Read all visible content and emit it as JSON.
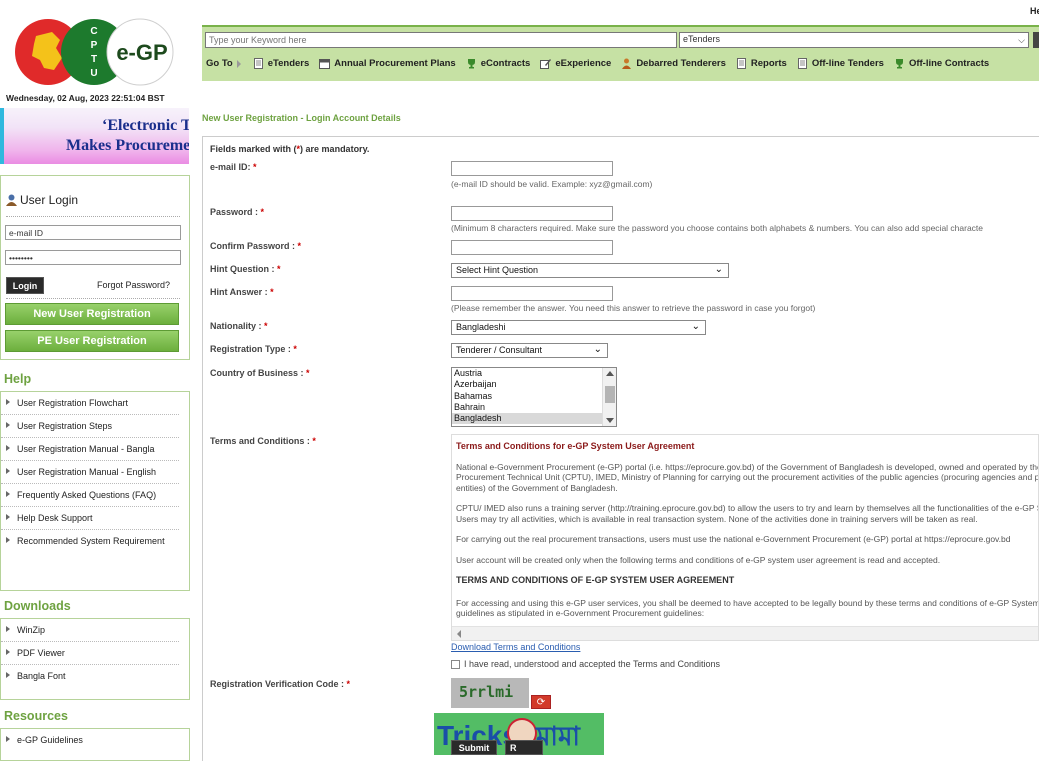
{
  "header": {
    "corner_text": "He",
    "datetime": "Wednesday, 02 Aug, 2023 22:51:04 BST",
    "logo_letters": [
      "C",
      "P",
      "T",
      "U"
    ],
    "logo_text": "e-GP",
    "banner_line1": "‘Electronic Te",
    "banner_line2": "Makes Procuremer"
  },
  "search": {
    "keyword_placeholder": "Type your Keyword here",
    "category_value": "eTenders"
  },
  "menu": {
    "goto_label": "Go To",
    "items": [
      {
        "label": "eTenders",
        "icon": "document-icon"
      },
      {
        "label": "Annual Procurement Plans",
        "icon": "calendar-icon"
      },
      {
        "label": "eContracts",
        "icon": "trophy-icon"
      },
      {
        "label": "eExperience",
        "icon": "edit-icon"
      },
      {
        "label": "Debarred Tenderers",
        "icon": "person-icon"
      },
      {
        "label": "Reports",
        "icon": "document-icon"
      },
      {
        "label": "Off-line Tenders",
        "icon": "document-icon"
      },
      {
        "label": "Off-line Contracts",
        "icon": "trophy-icon"
      }
    ]
  },
  "login": {
    "title": "User Login",
    "email_value": "e-mail ID",
    "password_value": "••••••••",
    "login_label": "Login",
    "forgot_label": "Forgot Password?",
    "new_user_label": "New User Registration",
    "pe_user_label": "PE User Registration"
  },
  "help": {
    "title": "Help",
    "items": [
      "User Registration Flowchart",
      "User Registration Steps",
      "User Registration Manual - Bangla",
      "User Registration Manual - English",
      "Frequently Asked Questions (FAQ)",
      "Help Desk Support",
      "Recommended System Requirement"
    ]
  },
  "downloads": {
    "title": "Downloads",
    "items": [
      "WinZip",
      "PDF Viewer",
      "Bangla Font"
    ]
  },
  "resources": {
    "title": "Resources",
    "items": [
      "e-GP Guidelines"
    ]
  },
  "form": {
    "page_title": "New User Registration - Login Account Details",
    "mandatory_pre": "Fields marked with (",
    "mandatory_star": "*",
    "mandatory_post": ") are mandatory.",
    "email_label": "e-mail ID: ",
    "email_hint": "(e-mail ID should be valid. Example: xyz@gmail.com)",
    "password_label": "Password : ",
    "password_hint": "(Minimum 8 characters required. Make sure the password you choose contains both alphabets & numbers. You can also add special characte",
    "confirm_label": "Confirm Password : ",
    "hint_q_label": "Hint Question : ",
    "hint_q_value": "Select Hint Question",
    "hint_a_label": "Hint Answer : ",
    "hint_a_hint": "(Please remember the answer. You need this answer to retrieve the password in case you forgot)",
    "nationality_label": "Nationality : ",
    "nationality_value": "Bangladeshi",
    "reg_type_label": "Registration Type : ",
    "reg_type_value": "Tenderer / Consultant",
    "country_label": "Country of Business : ",
    "countries": [
      "Austria",
      "Azerbaijan",
      "Bahamas",
      "Bahrain",
      "Bangladesh"
    ],
    "terms_label": "Terms and Conditions : ",
    "star": "*",
    "download_terms": "Download Terms and Conditions",
    "agree_label": "I have read, understood and accepted the Terms and Conditions",
    "captcha_label": "Registration Verification Code : ",
    "captcha_text": "5rrlmi",
    "submit_label": "Submit",
    "reset_label": "R"
  },
  "terms": {
    "title": "Terms and Conditions for e-GP System User Agreement",
    "p1": "National e-Government Procurement (e-GP) portal (i.e. https://eprocure.gov.bd) of the Government of Bangladesh is developed, owned and operated by the Central Procurement Technical Unit (CPTU), IMED, Ministry of Planning for carrying out the procurement activities of the public agencies (procuring agencies and procuring entities) of the Government of Bangladesh.",
    "p2": "CPTU/ IMED also runs a training server (http://training.eprocure.gov.bd) to allow the users to try and learn by themselves all the functionalities of the e-GP System. Users may try all activities, which is available in real transaction system. None of the activities done in training servers will be taken as real.",
    "p3": "For carrying out the real procurement transactions, users must use the national e-Government Procurement (e-GP) portal at https://eprocure.gov.bd",
    "p4": "User account will be created only when the following terms and conditions of e-GP system user agreement is read and accepted.",
    "heading": "TERMS AND CONDITIONS OF E-GP SYSTEM USER AGREEMENT",
    "p5": "For accessing and using this e-GP user services, you shall be deemed to have accepted to be legally bound by these terms and conditions of e-GP System and guidelines as stipulated in e-Government Procurement guidelines:"
  },
  "watermark": {
    "text_left": "Tricks",
    "text_right": "মামা"
  }
}
